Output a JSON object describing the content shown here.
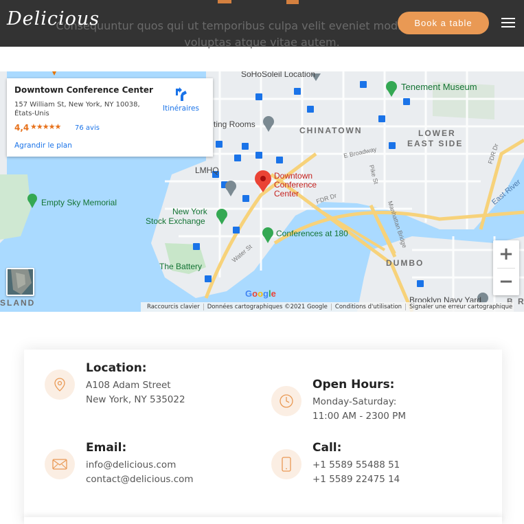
{
  "header": {
    "logo": "Delicious",
    "book_button": "Book a table",
    "background_text_line1": "Consequuntur quos qui ut temporibus culpa velit eveniet modi omnis est a",
    "background_text_line2": "voluptas atque vitae autem.",
    "accent_color": "#e99954"
  },
  "map": {
    "place_name": "Downtown Conference Center",
    "place_address": "157 William St, New York, NY 10038, États-Unis",
    "rating": "4,4",
    "reviews": "76 avis",
    "enlarge_link": "Agrandir le plan",
    "directions_label": "Itinéraires",
    "marker_label": "Downtown Conference Center",
    "labels": {
      "soho": "SoHoSoleil Location",
      "tenement": "Tenement Museum",
      "chinatown": "CHINATOWN",
      "lower_east_side_1": "LOWER",
      "lower_east_side_2": "EAST SIDE",
      "rooms": "ting Rooms",
      "broadway": "E Broadway",
      "pike": "Pike St",
      "fdr1": "FDR Dr",
      "fdr2": "FDR Dr",
      "lmhq": "LMHQ",
      "empty_sky": "Empty Sky Memorial",
      "nyse1": "New York",
      "nyse2": "Stock Exchange",
      "conferences": "Conferences at 180",
      "manhattan_bridge": "Manhattan Bridge",
      "east_river": "East River",
      "water_st": "Water St",
      "battery": "The Battery",
      "dumbo": "DUMBO",
      "navy_yard": "Brooklyn Navy Yard",
      "island": "SLAND",
      "brp": "B R P"
    },
    "google": "Google",
    "footer": [
      "Raccourcis clavier",
      "Données cartographiques ©2021 Google",
      "Conditions d'utilisation",
      "Signaler une erreur cartographique"
    ],
    "zoom_in": "+",
    "zoom_out": "−"
  },
  "contact": {
    "location": {
      "title": "Location:",
      "line1": "A108 Adam Street",
      "line2": "New York, NY 535022",
      "icon": "map-pin-icon"
    },
    "hours": {
      "title": "Open Hours:",
      "line1": "Monday-Saturday:",
      "line2": "11:00 AM - 2300 PM",
      "icon": "clock-icon"
    },
    "email": {
      "title": "Email:",
      "line1": "info@delicious.com",
      "line2": "contact@delicious.com",
      "icon": "envelope-icon"
    },
    "call": {
      "title": "Call:",
      "line1": "+1 5589 55488 51",
      "line2": "+1 5589 22475 14",
      "icon": "phone-icon"
    }
  }
}
